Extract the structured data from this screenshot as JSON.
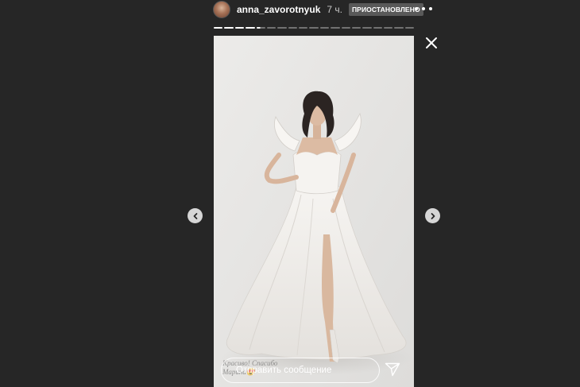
{
  "header": {
    "username": "anna_zavorotnyuk",
    "time": "7 ч.",
    "status_badge": "ПРИОСТАНОВЛЕНО",
    "more_icon": "more-horizontal-icon"
  },
  "progress": {
    "segments_total": 19,
    "segments_viewed": 4,
    "current_segment_fraction": 0.4
  },
  "story": {
    "caption": "Красиво! Спасибо\nМарина",
    "caption_emoji": "😍"
  },
  "navigation": {
    "prev_icon": "chevron-left-icon",
    "next_icon": "chevron-right-icon",
    "close_icon": "close-icon"
  },
  "reply": {
    "placeholder": "Отправить сообщение",
    "send_icon": "paper-plane-icon"
  },
  "colors": {
    "background": "#262626",
    "text": "#ffffff",
    "badge": "#595959"
  }
}
